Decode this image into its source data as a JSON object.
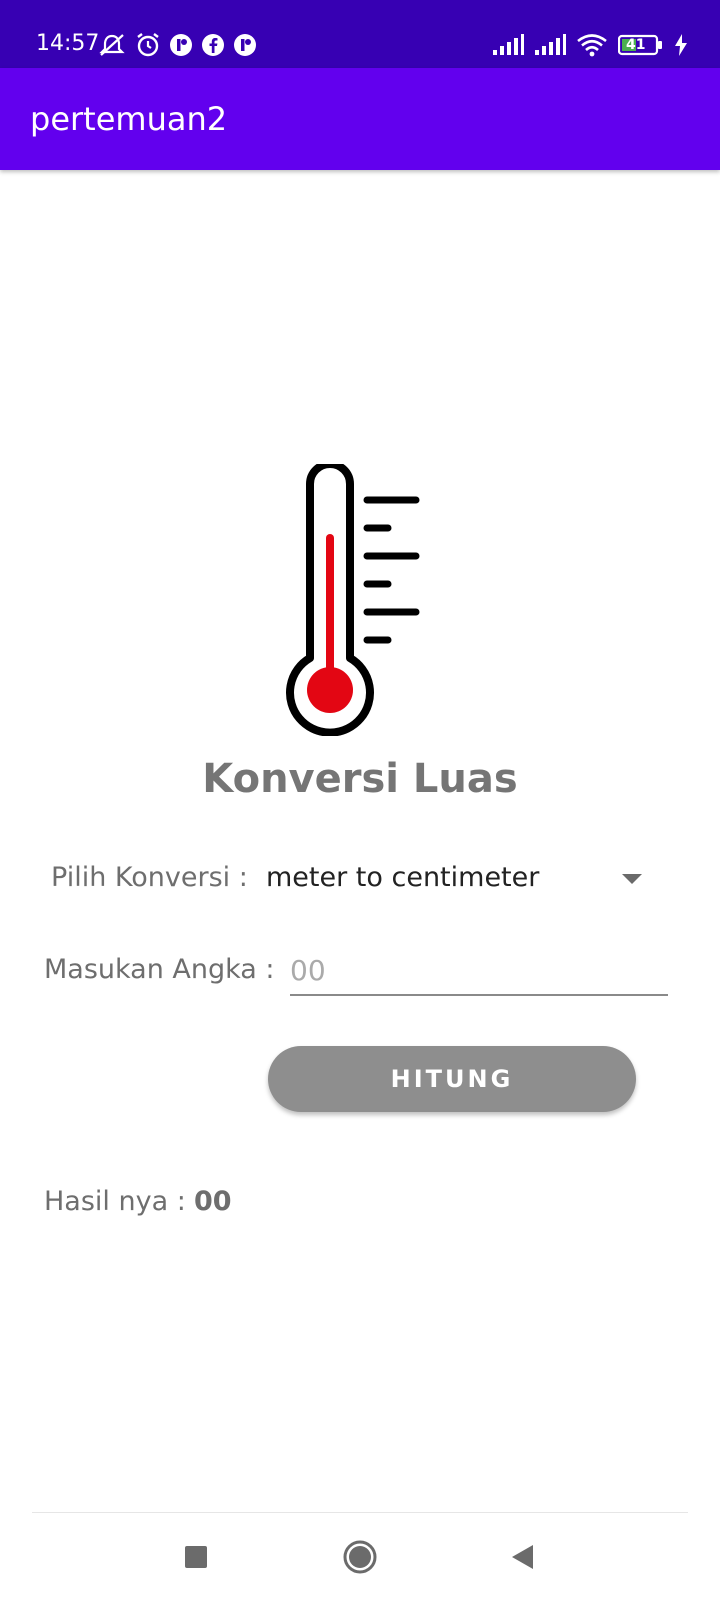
{
  "status_bar": {
    "time": "14:57",
    "battery": "41",
    "left_icons": [
      "mute-bell-icon",
      "alarm-icon",
      "app-notification-icon",
      "facebook-icon",
      "app-notification-icon"
    ],
    "right_icons": [
      "signal-icon",
      "signal-icon",
      "wifi-icon",
      "battery-icon",
      "charging-icon"
    ]
  },
  "app_bar": {
    "title": "pertemuan2",
    "color": "#6200EE",
    "status_color": "#3700B3"
  },
  "main": {
    "heading": "Konversi Luas",
    "conversion_label": "Pilih Konversi :",
    "conversion_selected": "meter to centimeter",
    "number_label": "Masukan Angka :",
    "number_placeholder": "00",
    "number_value": "",
    "button_label": "HITUNG",
    "result_label": "Hasil nya :",
    "result_value": "00"
  },
  "nav_bar": {
    "icons": [
      "recent-apps-icon",
      "home-icon",
      "back-icon"
    ]
  }
}
